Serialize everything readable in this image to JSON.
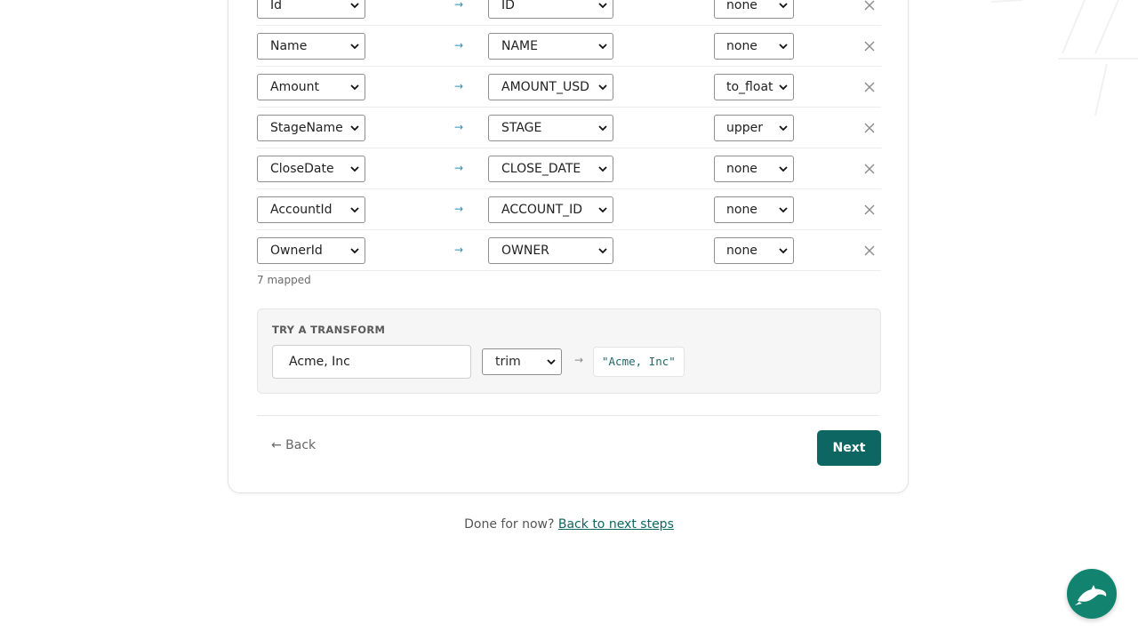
{
  "mappings": [
    {
      "source": "Id",
      "target": "ID",
      "transform": "none"
    },
    {
      "source": "Name",
      "target": "NAME",
      "transform": "none"
    },
    {
      "source": "Amount",
      "target": "AMOUNT_USD",
      "transform": "to_float"
    },
    {
      "source": "StageName",
      "target": "STAGE",
      "transform": "upper"
    },
    {
      "source": "CloseDate",
      "target": "CLOSE_DATE",
      "transform": "none"
    },
    {
      "source": "AccountId",
      "target": "ACCOUNT_ID",
      "transform": "none"
    },
    {
      "source": "OwnerId",
      "target": "OWNER",
      "transform": "none"
    }
  ],
  "mapped_count": "7 mapped",
  "arrow_glyph": "→",
  "try_transform": {
    "title": "TRY A TRANSFORM",
    "input_value": "Acme, Inc",
    "selected_transform": "trim",
    "arrow_glyph": "→",
    "result": "\"Acme, Inc\""
  },
  "nav": {
    "back_label": "← Back",
    "next_label": "Next"
  },
  "footer": {
    "text": "Done for now?",
    "link_label": "Back to next steps"
  },
  "colors": {
    "accent": "#0d6662",
    "arrow": "#2f8fb8",
    "fab": "#12836e"
  },
  "icons": {
    "remove": "close-icon",
    "caret": "chevron-down-icon",
    "fab": "dolphin-icon"
  }
}
